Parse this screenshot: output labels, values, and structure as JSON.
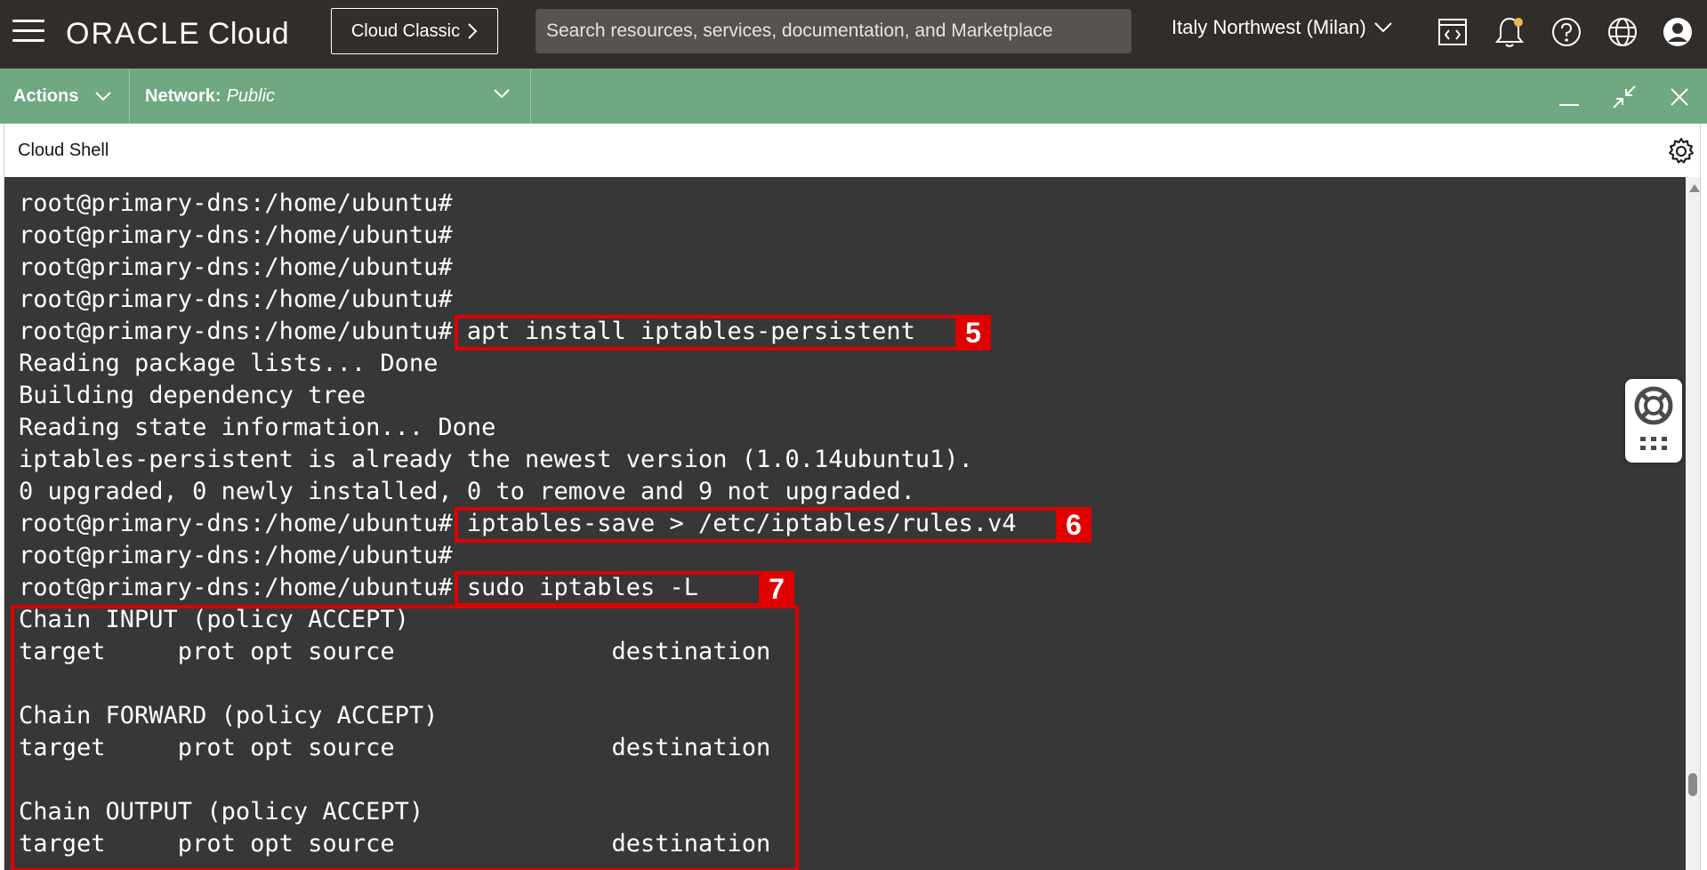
{
  "header": {
    "logo_brand": "ORACLE",
    "logo_product": "Cloud",
    "classic_button": "Cloud Classic",
    "search_placeholder": "Search resources, services, documentation, and Marketplace",
    "region": "Italy Northwest (Milan)",
    "icons": [
      "code-editor-icon",
      "bell-icon",
      "help-icon",
      "globe-icon",
      "user-icon"
    ]
  },
  "actionbar": {
    "actions_label": "Actions",
    "network_label": "Network:",
    "network_value": "Public",
    "window_controls": [
      "minimize-icon",
      "restore-icon",
      "close-icon"
    ]
  },
  "shell": {
    "title": "Cloud Shell"
  },
  "terminal": {
    "prompt": "root@primary-dns:/home/ubuntu#",
    "lines": [
      "root@primary-dns:/home/ubuntu#",
      "root@primary-dns:/home/ubuntu#",
      "root@primary-dns:/home/ubuntu#",
      "root@primary-dns:/home/ubuntu#",
      "root@primary-dns:/home/ubuntu# apt install iptables-persistent",
      "Reading package lists... Done",
      "Building dependency tree",
      "Reading state information... Done",
      "iptables-persistent is already the newest version (1.0.14ubuntu1).",
      "0 upgraded, 0 newly installed, 0 to remove and 9 not upgraded.",
      "root@primary-dns:/home/ubuntu# iptables-save > /etc/iptables/rules.v4",
      "root@primary-dns:/home/ubuntu#",
      "root@primary-dns:/home/ubuntu# sudo iptables -L",
      "Chain INPUT (policy ACCEPT)",
      "target     prot opt source               destination",
      "",
      "Chain FORWARD (policy ACCEPT)",
      "target     prot opt source               destination",
      "",
      "Chain OUTPUT (policy ACCEPT)",
      "target     prot opt source               destination"
    ]
  },
  "annotations": {
    "step5": "5",
    "step6": "6",
    "step7": "7"
  },
  "colors": {
    "topbar": "#312d2a",
    "actionbar": "#6fa881",
    "terminal_bg": "#373737",
    "highlight": "#e00000"
  }
}
